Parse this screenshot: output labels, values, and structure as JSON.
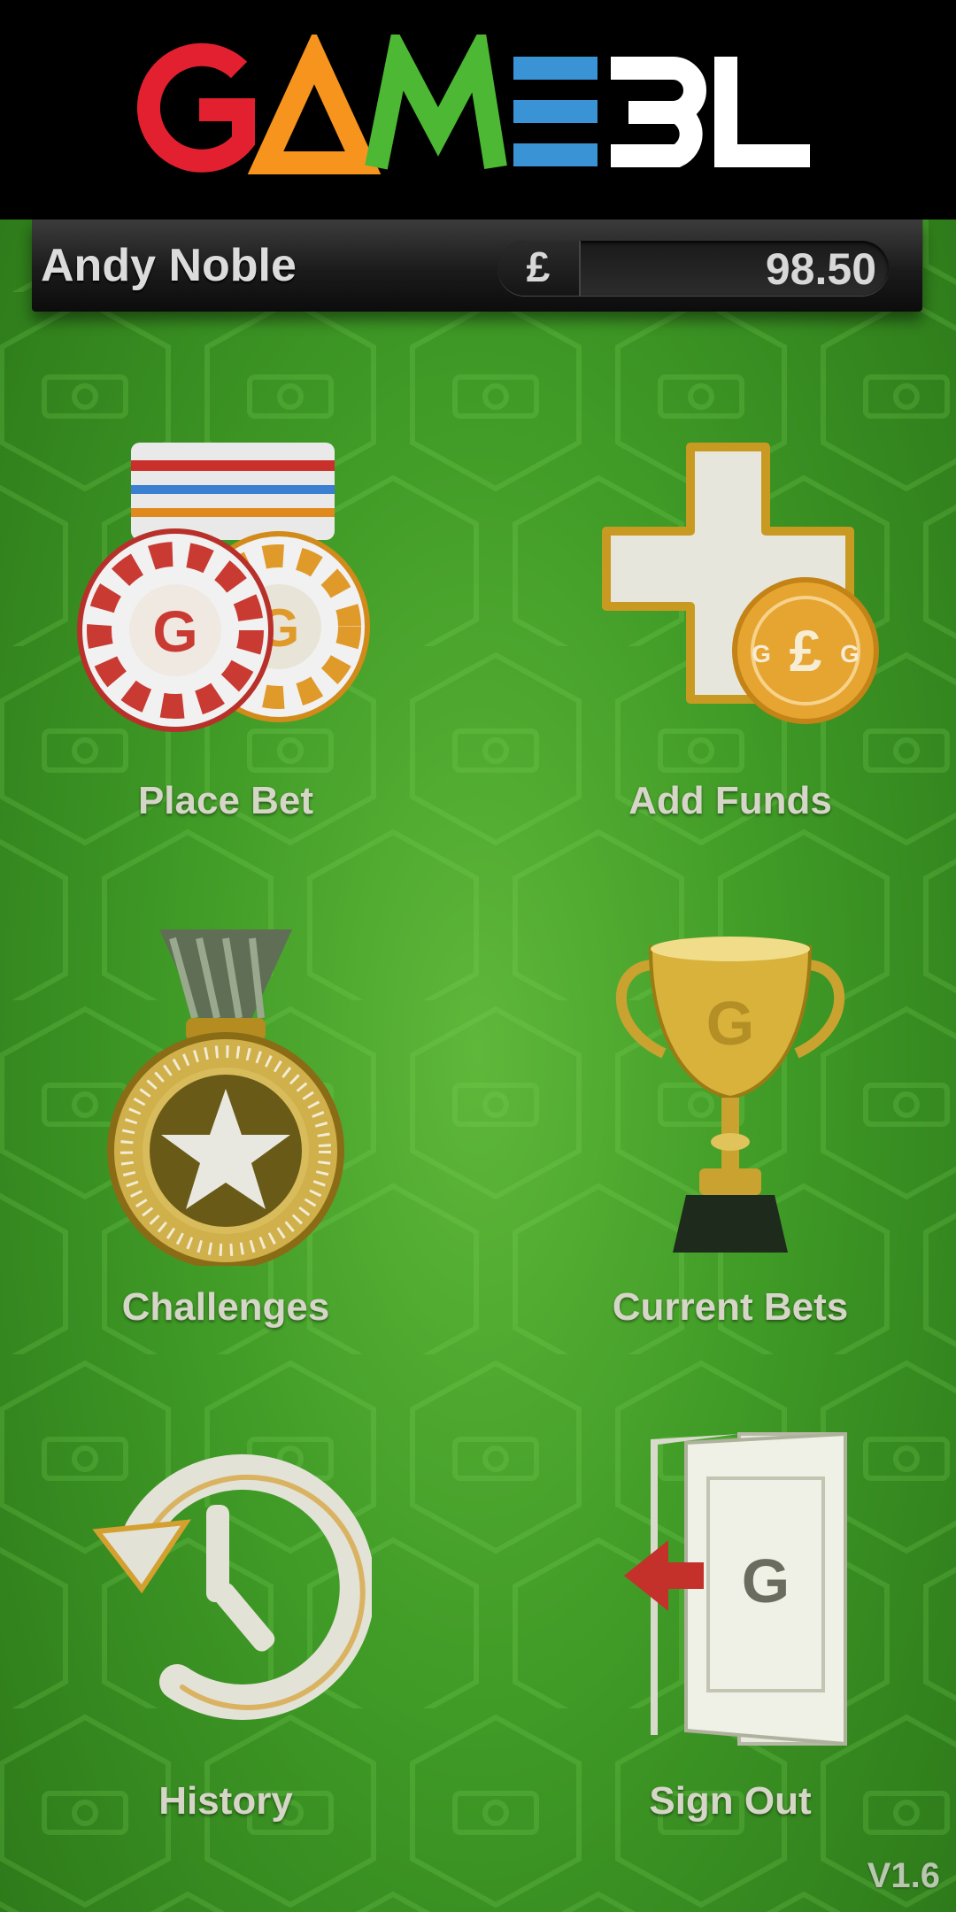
{
  "app": {
    "logo_text": "GAMEBL",
    "logo_letter_colors": [
      "#e3202f",
      "#f7941d",
      "#4cb833",
      "#3a93d4",
      "#ffffff",
      "#ffffff"
    ],
    "version": "V1.6"
  },
  "user": {
    "name": "Andy Noble",
    "currency_symbol": "£",
    "balance": "98.50"
  },
  "menu": [
    {
      "label": "Place Bet",
      "icon": "casino-chips-icon"
    },
    {
      "label": "Add Funds",
      "icon": "plus-coin-icon"
    },
    {
      "label": "Challenges",
      "icon": "star-medal-icon"
    },
    {
      "label": "Current Bets",
      "icon": "trophy-icon"
    },
    {
      "label": "History",
      "icon": "history-clock-icon"
    },
    {
      "label": "Sign Out",
      "icon": "exit-door-icon"
    }
  ],
  "colors": {
    "background_green": "#3f9a26",
    "header_black": "#000000",
    "label_text": "#d6d6c8"
  }
}
